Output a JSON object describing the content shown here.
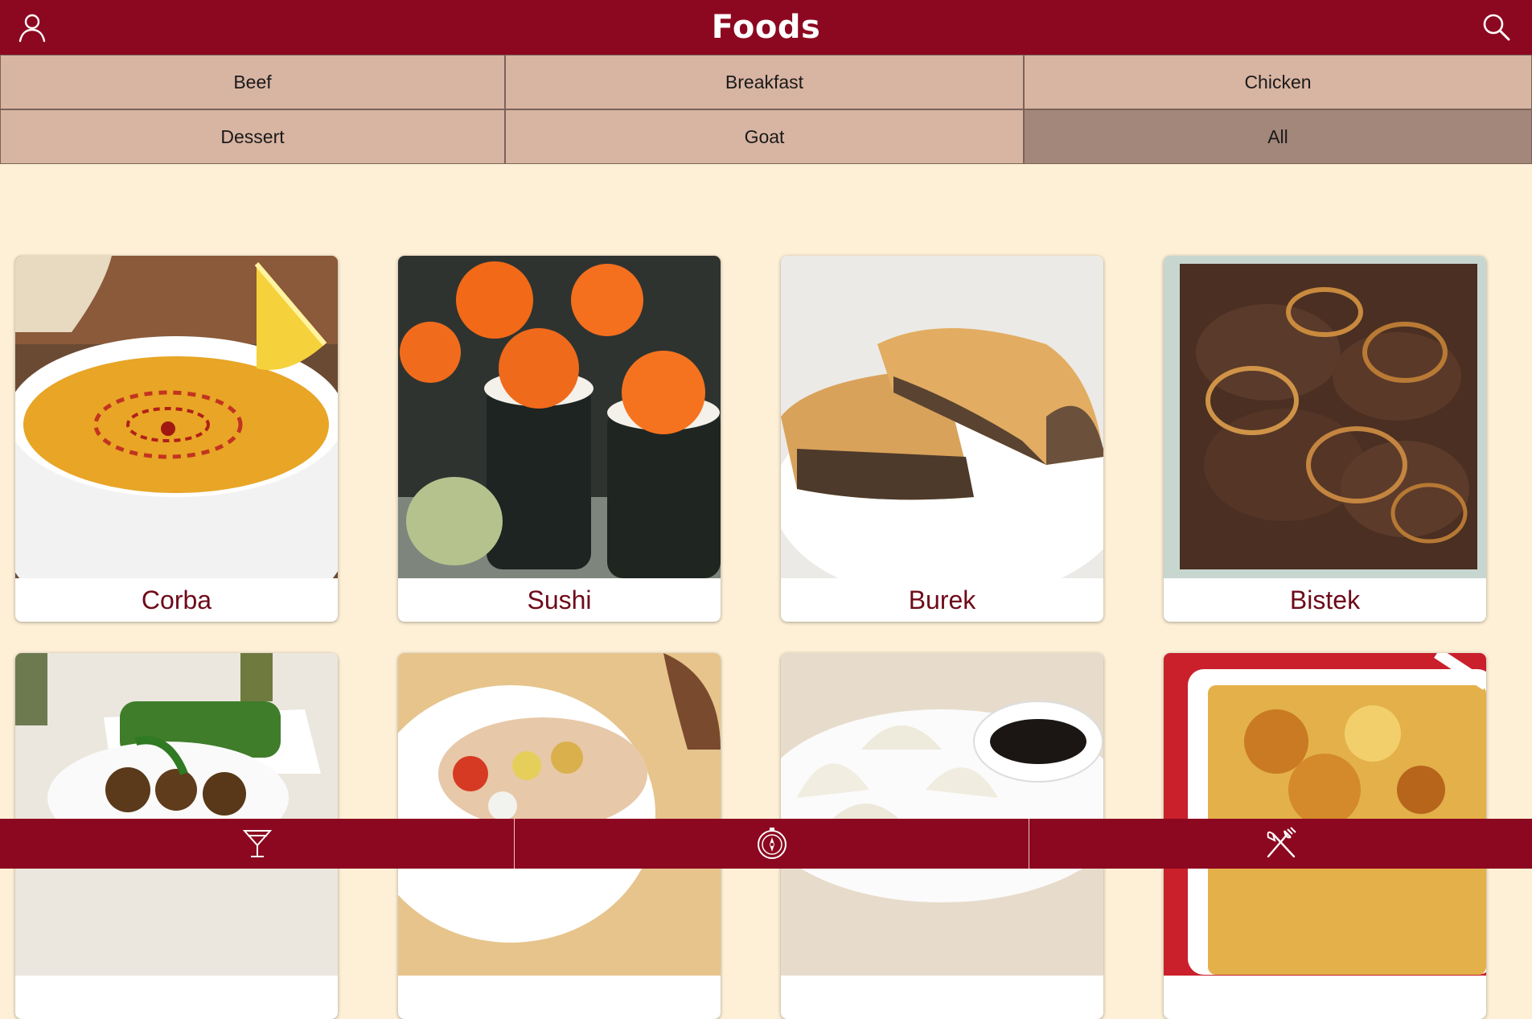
{
  "header": {
    "title": "Foods",
    "icons": [
      "user-icon",
      "search-icon"
    ]
  },
  "categories": [
    "Beef",
    "Breakfast",
    "Chicken",
    "Dessert",
    "Goat",
    "All"
  ],
  "selected_category": "All",
  "foods": [
    {
      "name": "Corba"
    },
    {
      "name": "Sushi"
    },
    {
      "name": "Burek"
    },
    {
      "name": "Bistek"
    },
    {
      "name": ""
    },
    {
      "name": ""
    },
    {
      "name": ""
    },
    {
      "name": ""
    }
  ],
  "bottom_nav": [
    {
      "icon": "cocktail-icon"
    },
    {
      "icon": "compass-icon"
    },
    {
      "icon": "fork-knife-icon"
    }
  ],
  "colors": {
    "brand": "#8c0820",
    "background": "#fdf0d6",
    "category": "#d8b4a2",
    "category_active": "#a3877a",
    "card_title": "#6e0a1a"
  }
}
